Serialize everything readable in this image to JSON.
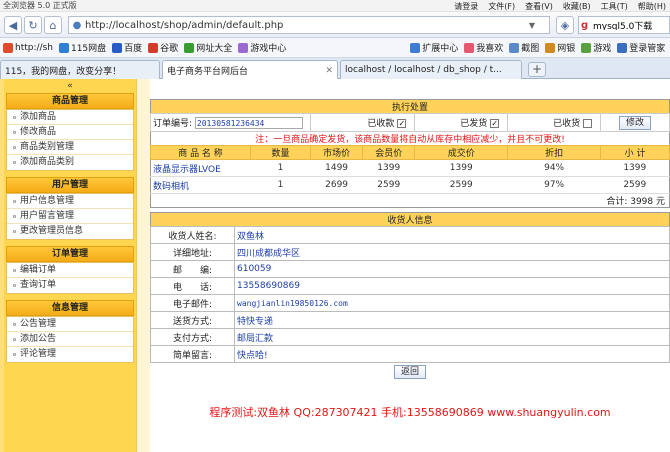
{
  "browser": {
    "title": "全浏览器 5.0 正式版",
    "menus": [
      "请登录",
      "文件(F)",
      "查看(V)",
      "收藏(B)",
      "工具(T)",
      "帮助(H)"
    ],
    "url": "http://localhost/shop/admin/default.php",
    "search_text": "mysql5.0下载",
    "favorites": [
      {
        "label": "http://sh",
        "color": "#e34a2a"
      },
      {
        "label": "115网盘",
        "color": "#2e7fd1"
      },
      {
        "label": "百度",
        "color": "#2a5cc8"
      },
      {
        "label": "谷歌",
        "color": "#d23c2c"
      },
      {
        "label": "网址大全",
        "color": "#3c9c34"
      },
      {
        "label": "游戏中心",
        "color": "#9a6ad0"
      },
      {
        "label": "扩展中心",
        "color": "#3c7cd4"
      },
      {
        "label": "我喜欢",
        "color": "#e35a70"
      },
      {
        "label": "截图",
        "color": "#5a8ac8"
      },
      {
        "label": "网银",
        "color": "#d08a20"
      },
      {
        "label": "游戏",
        "color": "#58a040"
      },
      {
        "label": "登录管家",
        "color": "#3a6cc0"
      }
    ],
    "tabs": [
      {
        "label": "115，我的网盘，改变分享！"
      },
      {
        "label": "电子商务平台网后台"
      },
      {
        "label": "localhost / localhost / db_shop / t..."
      }
    ]
  },
  "sidebar": {
    "collapse_label": "«",
    "groups": [
      {
        "title": "商品管理",
        "items": [
          "添加商品",
          "修改商品",
          "商品类别管理",
          "添加商品类别"
        ]
      },
      {
        "title": "用户管理",
        "items": [
          "用户信息管理",
          "用户留言管理",
          "更改管理员信息"
        ]
      },
      {
        "title": "订单管理",
        "items": [
          "编辑订单",
          "查询订单"
        ]
      },
      {
        "title": "信息管理",
        "items": [
          "公告管理",
          "添加公告",
          "评论管理"
        ]
      }
    ]
  },
  "order": {
    "section_title": "执行处置",
    "order_no_label": "订单编号:",
    "order_no": "20130581236434",
    "status": [
      {
        "label": "已收款",
        "checked": true
      },
      {
        "label": "已发货",
        "checked": true
      },
      {
        "label": "已收货",
        "checked": false
      }
    ],
    "modify_button": "修改",
    "notice": "注：一旦商品确定发货，该商品数量将自动从库存中相应减少，并且不可更改!",
    "columns": [
      "商 品 名 称",
      "数量",
      "市场价",
      "会员价",
      "成交价",
      "折扣",
      "小 计"
    ],
    "rows": [
      [
        "液晶显示器LVOE",
        "1",
        "1499",
        "1399",
        "1399",
        "94%",
        "1399"
      ],
      [
        "数码相机",
        "1",
        "2699",
        "2599",
        "2599",
        "97%",
        "2599"
      ]
    ],
    "total": "合计: 3998 元"
  },
  "receiver": {
    "section_title": "收货人信息",
    "fields": [
      {
        "label": "收货人姓名:",
        "value": "双鱼林"
      },
      {
        "label": "详细地址:",
        "value": "四川成都成华区"
      },
      {
        "label": "邮　　编:",
        "value": "610059"
      },
      {
        "label": "电　　话:",
        "value": "13558690869"
      },
      {
        "label": "电子邮件:",
        "value": "wangjianlin19850126.com"
      },
      {
        "label": "送货方式:",
        "value": "特快专递"
      },
      {
        "label": "支付方式:",
        "value": "邮局汇款"
      },
      {
        "label": "简单留言:",
        "value": "快点哈!"
      }
    ],
    "back_button": "返回"
  },
  "footer": "程序测试:双鱼林 QQ:287307421 手机:13558690869 www.shuangyulin.com"
}
